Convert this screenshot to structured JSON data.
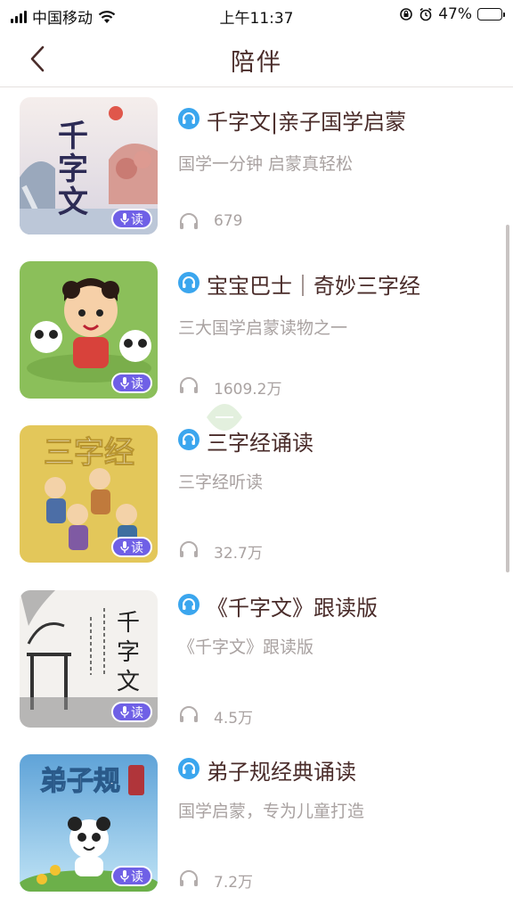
{
  "status_bar": {
    "carrier": "中国移动",
    "time": "上午11:37",
    "battery": "47%"
  },
  "nav": {
    "title": "陪伴",
    "back_icon": "chevron-left-icon"
  },
  "badge_label": "读",
  "items": [
    {
      "title": "千字文|亲子国学启蒙",
      "desc": "国学一分钟 启蒙真轻松",
      "count": "679"
    },
    {
      "title": "宝宝巴士｜奇妙三字经",
      "desc": "三大国学启蒙读物之一",
      "count": "1609.2万"
    },
    {
      "title": "三字经诵读",
      "desc": "三字经听读",
      "count": "32.7万",
      "cover_text": "三字经"
    },
    {
      "title": "《千字文》跟读版",
      "desc": "《千字文》跟读版",
      "count": "4.5万"
    },
    {
      "title": "弟子规经典诵读",
      "desc": "国学启蒙，专为儿童打造",
      "count": "7.2万",
      "cover_text": "弟子规"
    }
  ],
  "colors": {
    "accent_blue": "#3ba6ee",
    "badge_purple": "#6f60e6",
    "title_text": "#4a2c2a",
    "sub_text": "#a9a2a1"
  }
}
